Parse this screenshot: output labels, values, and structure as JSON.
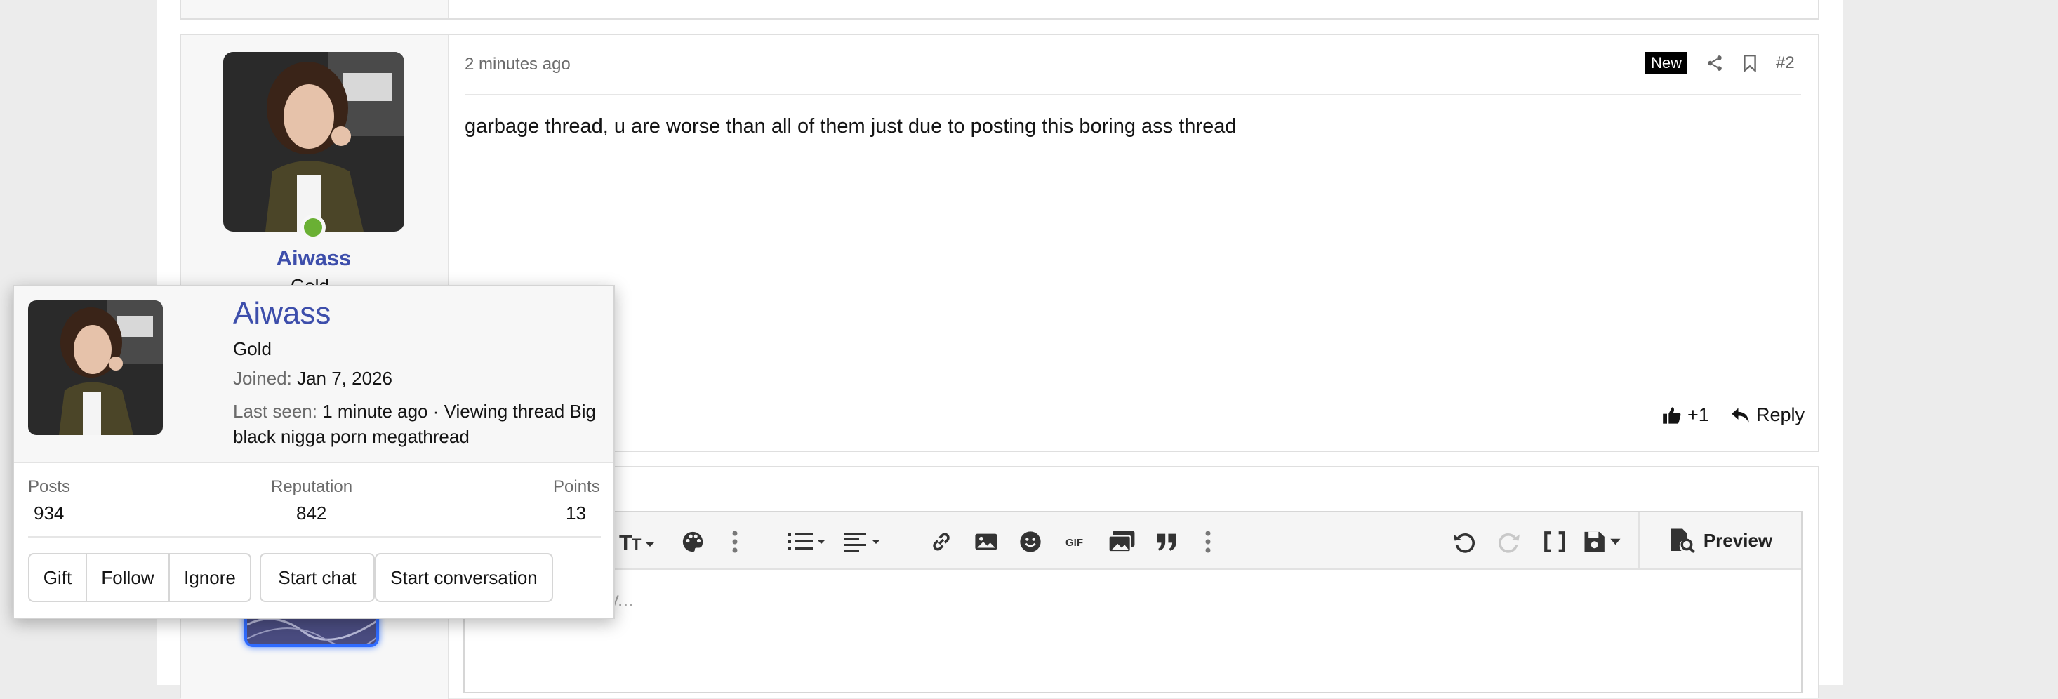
{
  "post": {
    "timestamp": "2 minutes ago",
    "new_badge": "New",
    "post_number": "#2",
    "body": "garbage thread, u are worse than all of them just due to posting this boring ass thread",
    "like_count": "+1",
    "reply_label": "Reply"
  },
  "author": {
    "username": "Aiwass",
    "title_partial": "Gold"
  },
  "editor": {
    "placeholder_visible": "ply...",
    "preview_label": "Preview",
    "tools_left": [
      "text-size-icon",
      "palette-icon",
      "more-icon",
      "list-icon",
      "align-icon",
      "more-icon"
    ],
    "tools_mid": [
      "link-icon",
      "image-icon",
      "smilie-icon",
      "gif-icon",
      "media-icon",
      "quote-icon",
      "more-icon"
    ],
    "tools_right": [
      "undo-icon",
      "redo-icon",
      "bbcode-icon",
      "drafts-icon"
    ]
  },
  "popup": {
    "username": "Aiwass",
    "rank": "Gold",
    "joined_label": "Joined:",
    "joined_value": "Jan 7, 2026",
    "last_seen_label": "Last seen:",
    "last_seen_value": "1 minute ago · Viewing thread Big",
    "last_seen_value_cont": "black nigga porn megathread",
    "stats": [
      {
        "label": "Posts",
        "value": "934"
      },
      {
        "label": "Reputation",
        "value": "842"
      },
      {
        "label": "Points",
        "value": "13"
      }
    ],
    "buttons": [
      "Gift",
      "Follow",
      "Ignore",
      "Start chat",
      "Start conversation"
    ]
  },
  "colors": {
    "username": "#3d4eab",
    "online": "#6ab034",
    "new_badge_bg": "#000000"
  }
}
